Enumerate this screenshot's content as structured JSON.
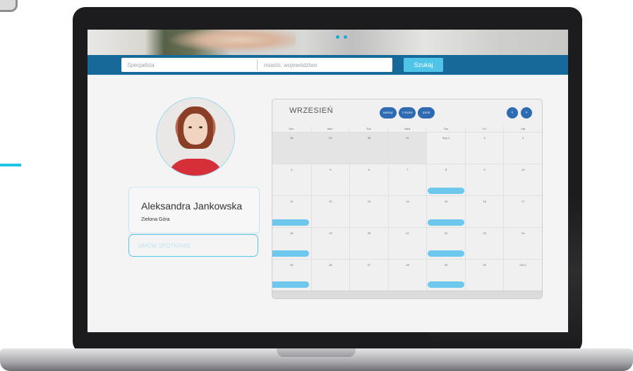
{
  "search": {
    "specialist_placeholder": "Specjalista",
    "location_placeholder": "miasto, województwo",
    "button_label": "Szukaj"
  },
  "profile": {
    "name": "Aleksandra Jankowska",
    "city": "Zielona Góra",
    "appointment_label": "UMÓW SPOTKANIE"
  },
  "calendar": {
    "month_title": "WRZESIEŃ",
    "view_buttons": [
      "MIESIĄC",
      "TYDZIEŃ",
      "DZIEŃ"
    ],
    "nav_prev": "<",
    "nav_next": ">",
    "weekdays": [
      "Sun",
      "Mon",
      "Tue",
      "Wed",
      "Thu",
      "Fri",
      "Sat"
    ],
    "weeks": [
      [
        "28",
        "29",
        "30",
        "31",
        "Sep 1",
        "2",
        "3"
      ],
      [
        "4",
        "5",
        "6",
        "7",
        "8",
        "9",
        "10"
      ],
      [
        "11",
        "12",
        "13",
        "14",
        "15",
        "16",
        "17"
      ],
      [
        "18",
        "19",
        "20",
        "21",
        "22",
        "23",
        "24"
      ],
      [
        "25",
        "26",
        "27",
        "28",
        "29",
        "30",
        "Oct 1"
      ]
    ]
  },
  "colors": {
    "accent": "#1fc3e4",
    "search_bar": "#17699a",
    "search_button": "#4fc3e8",
    "calendar_buttons": "#2f6bb2",
    "event": "#6ec7ec",
    "appointment_border": "#56c8ea"
  }
}
